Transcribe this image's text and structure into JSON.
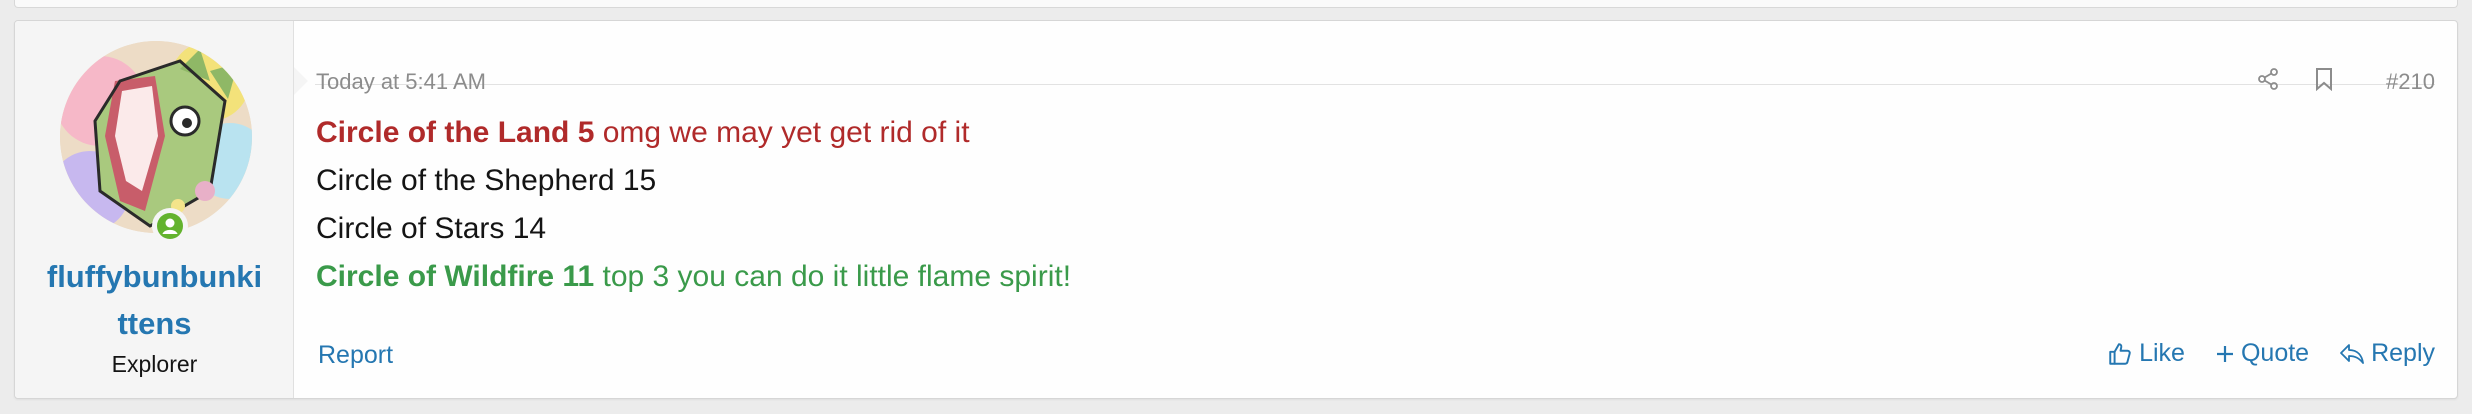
{
  "post": {
    "author": {
      "username": "fluffybunbunkittens",
      "username_line1": "fluffybunbunki",
      "username_line2": "ttens",
      "user_title": "Explorer",
      "status_icon": "user-online-icon"
    },
    "date": "Today at 5:41 AM",
    "post_number": "#210",
    "header_icons": [
      "share-icon",
      "bookmark-icon"
    ],
    "content": [
      {
        "bold": "Circle of the Land 5",
        "rest": " omg we may yet get rid of it",
        "color": "#b02a2a"
      },
      {
        "bold": "",
        "rest": "Circle of the Shepherd 15",
        "color": "#141414"
      },
      {
        "bold": "",
        "rest": "Circle of Stars 14",
        "color": "#141414"
      },
      {
        "bold": "Circle of Wildfire 11",
        "rest": " top 3 you can do it little flame spirit!",
        "color": "#3a9a4a"
      }
    ],
    "footer": {
      "report_label": "Report",
      "like_label": "Like",
      "quote_label": "Quote",
      "reply_label": "Reply"
    }
  },
  "colors": {
    "link": "#2577b1",
    "red_text": "#b02a2a",
    "green_text": "#3a9a4a",
    "status_green": "#63b32e"
  }
}
